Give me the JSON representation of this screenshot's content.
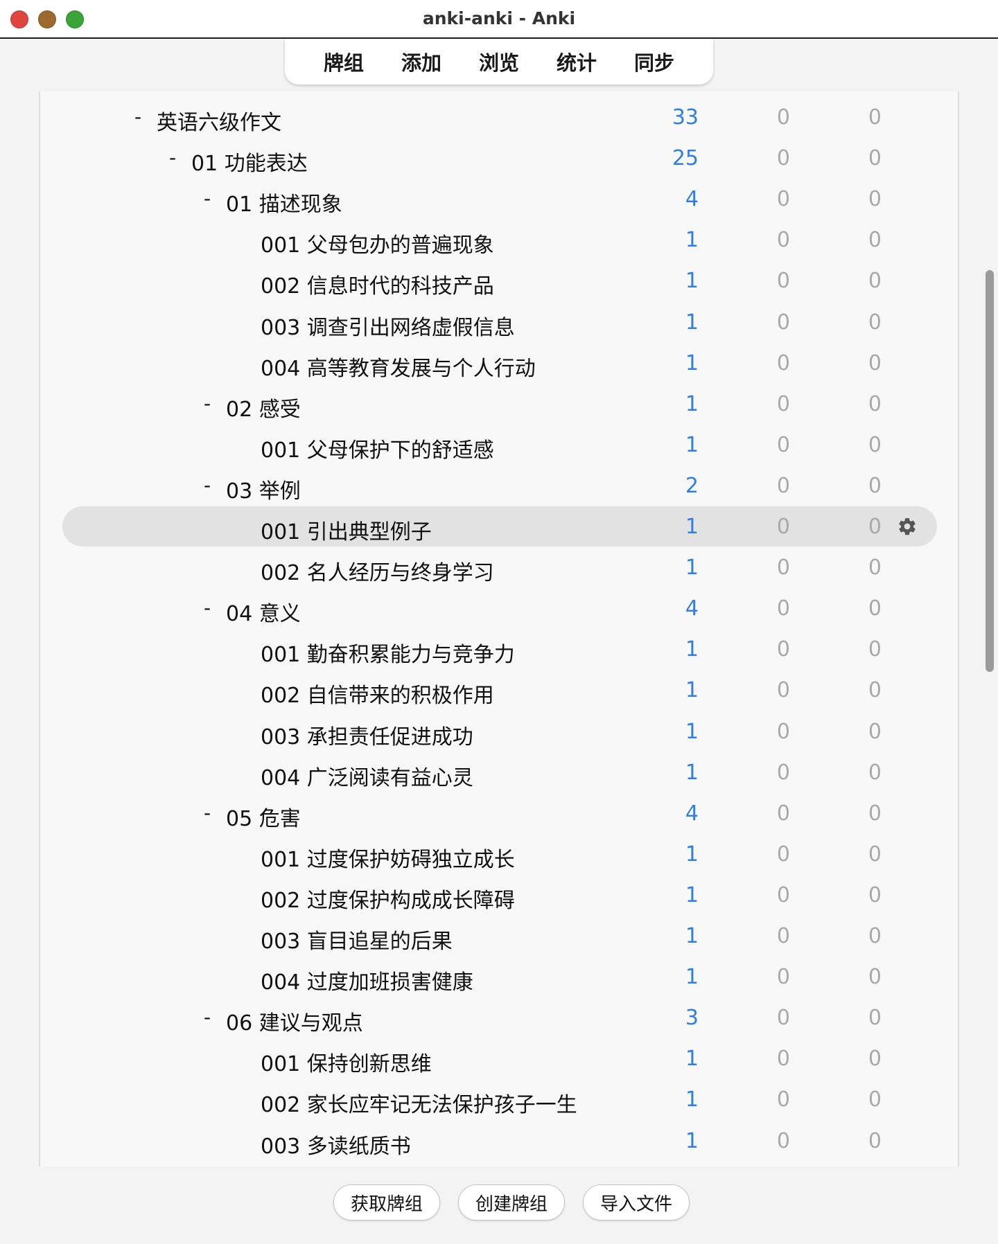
{
  "window": {
    "title": "anki-anki - Anki"
  },
  "toolbar": {
    "tabs": [
      "牌组",
      "添加",
      "浏览",
      "统计",
      "同步"
    ]
  },
  "deck_rows": [
    {
      "level": 0,
      "collapse": "-",
      "name": "英语六级作文",
      "new": "33",
      "learn": "0",
      "due": "0"
    },
    {
      "level": 1,
      "collapse": "-",
      "name": "01 功能表达",
      "new": "25",
      "learn": "0",
      "due": "0"
    },
    {
      "level": 2,
      "collapse": "-",
      "name": "01 描述现象",
      "new": "4",
      "learn": "0",
      "due": "0"
    },
    {
      "level": 3,
      "collapse": "",
      "name": "001 父母包办的普遍现象",
      "new": "1",
      "learn": "0",
      "due": "0"
    },
    {
      "level": 3,
      "collapse": "",
      "name": "002 信息时代的科技产品",
      "new": "1",
      "learn": "0",
      "due": "0"
    },
    {
      "level": 3,
      "collapse": "",
      "name": "003 调查引出网络虚假信息",
      "new": "1",
      "learn": "0",
      "due": "0"
    },
    {
      "level": 3,
      "collapse": "",
      "name": "004 高等教育发展与个人行动",
      "new": "1",
      "learn": "0",
      "due": "0"
    },
    {
      "level": 2,
      "collapse": "-",
      "name": "02 感受",
      "new": "1",
      "learn": "0",
      "due": "0"
    },
    {
      "level": 3,
      "collapse": "",
      "name": "001 父母保护下的舒适感",
      "new": "1",
      "learn": "0",
      "due": "0"
    },
    {
      "level": 2,
      "collapse": "-",
      "name": "03 举例",
      "new": "2",
      "learn": "0",
      "due": "0"
    },
    {
      "level": 3,
      "collapse": "",
      "name": "001 引出典型例子",
      "new": "1",
      "learn": "0",
      "due": "0",
      "current": true
    },
    {
      "level": 3,
      "collapse": "",
      "name": "002 名人经历与终身学习",
      "new": "1",
      "learn": "0",
      "due": "0"
    },
    {
      "level": 2,
      "collapse": "-",
      "name": "04 意义",
      "new": "4",
      "learn": "0",
      "due": "0"
    },
    {
      "level": 3,
      "collapse": "",
      "name": "001 勤奋积累能力与竞争力",
      "new": "1",
      "learn": "0",
      "due": "0"
    },
    {
      "level": 3,
      "collapse": "",
      "name": "002 自信带来的积极作用",
      "new": "1",
      "learn": "0",
      "due": "0"
    },
    {
      "level": 3,
      "collapse": "",
      "name": "003 承担责任促进成功",
      "new": "1",
      "learn": "0",
      "due": "0"
    },
    {
      "level": 3,
      "collapse": "",
      "name": "004 广泛阅读有益心灵",
      "new": "1",
      "learn": "0",
      "due": "0"
    },
    {
      "level": 2,
      "collapse": "-",
      "name": "05 危害",
      "new": "4",
      "learn": "0",
      "due": "0"
    },
    {
      "level": 3,
      "collapse": "",
      "name": "001 过度保护妨碍独立成长",
      "new": "1",
      "learn": "0",
      "due": "0"
    },
    {
      "level": 3,
      "collapse": "",
      "name": "002 过度保护构成成长障碍",
      "new": "1",
      "learn": "0",
      "due": "0"
    },
    {
      "level": 3,
      "collapse": "",
      "name": "003 盲目追星的后果",
      "new": "1",
      "learn": "0",
      "due": "0"
    },
    {
      "level": 3,
      "collapse": "",
      "name": "004 过度加班损害健康",
      "new": "1",
      "learn": "0",
      "due": "0"
    },
    {
      "level": 2,
      "collapse": "-",
      "name": "06 建议与观点",
      "new": "3",
      "learn": "0",
      "due": "0"
    },
    {
      "level": 3,
      "collapse": "",
      "name": "001 保持创新思维",
      "new": "1",
      "learn": "0",
      "due": "0"
    },
    {
      "level": 3,
      "collapse": "",
      "name": "002 家长应牢记无法保护孩子一生",
      "new": "1",
      "learn": "0",
      "due": "0"
    },
    {
      "level": 3,
      "collapse": "",
      "name": "003 多读纸质书",
      "new": "1",
      "learn": "0",
      "due": "0"
    }
  ],
  "colors": {
    "new_count": "#2f7fe0",
    "zero_count": "#a9a9a9",
    "current_row": "#e2e2e2"
  },
  "icons": {
    "row_options": "gear-icon"
  },
  "bottom_buttons": {
    "get_shared": "获取牌组",
    "create_deck": "创建牌组",
    "import_file": "导入文件"
  }
}
